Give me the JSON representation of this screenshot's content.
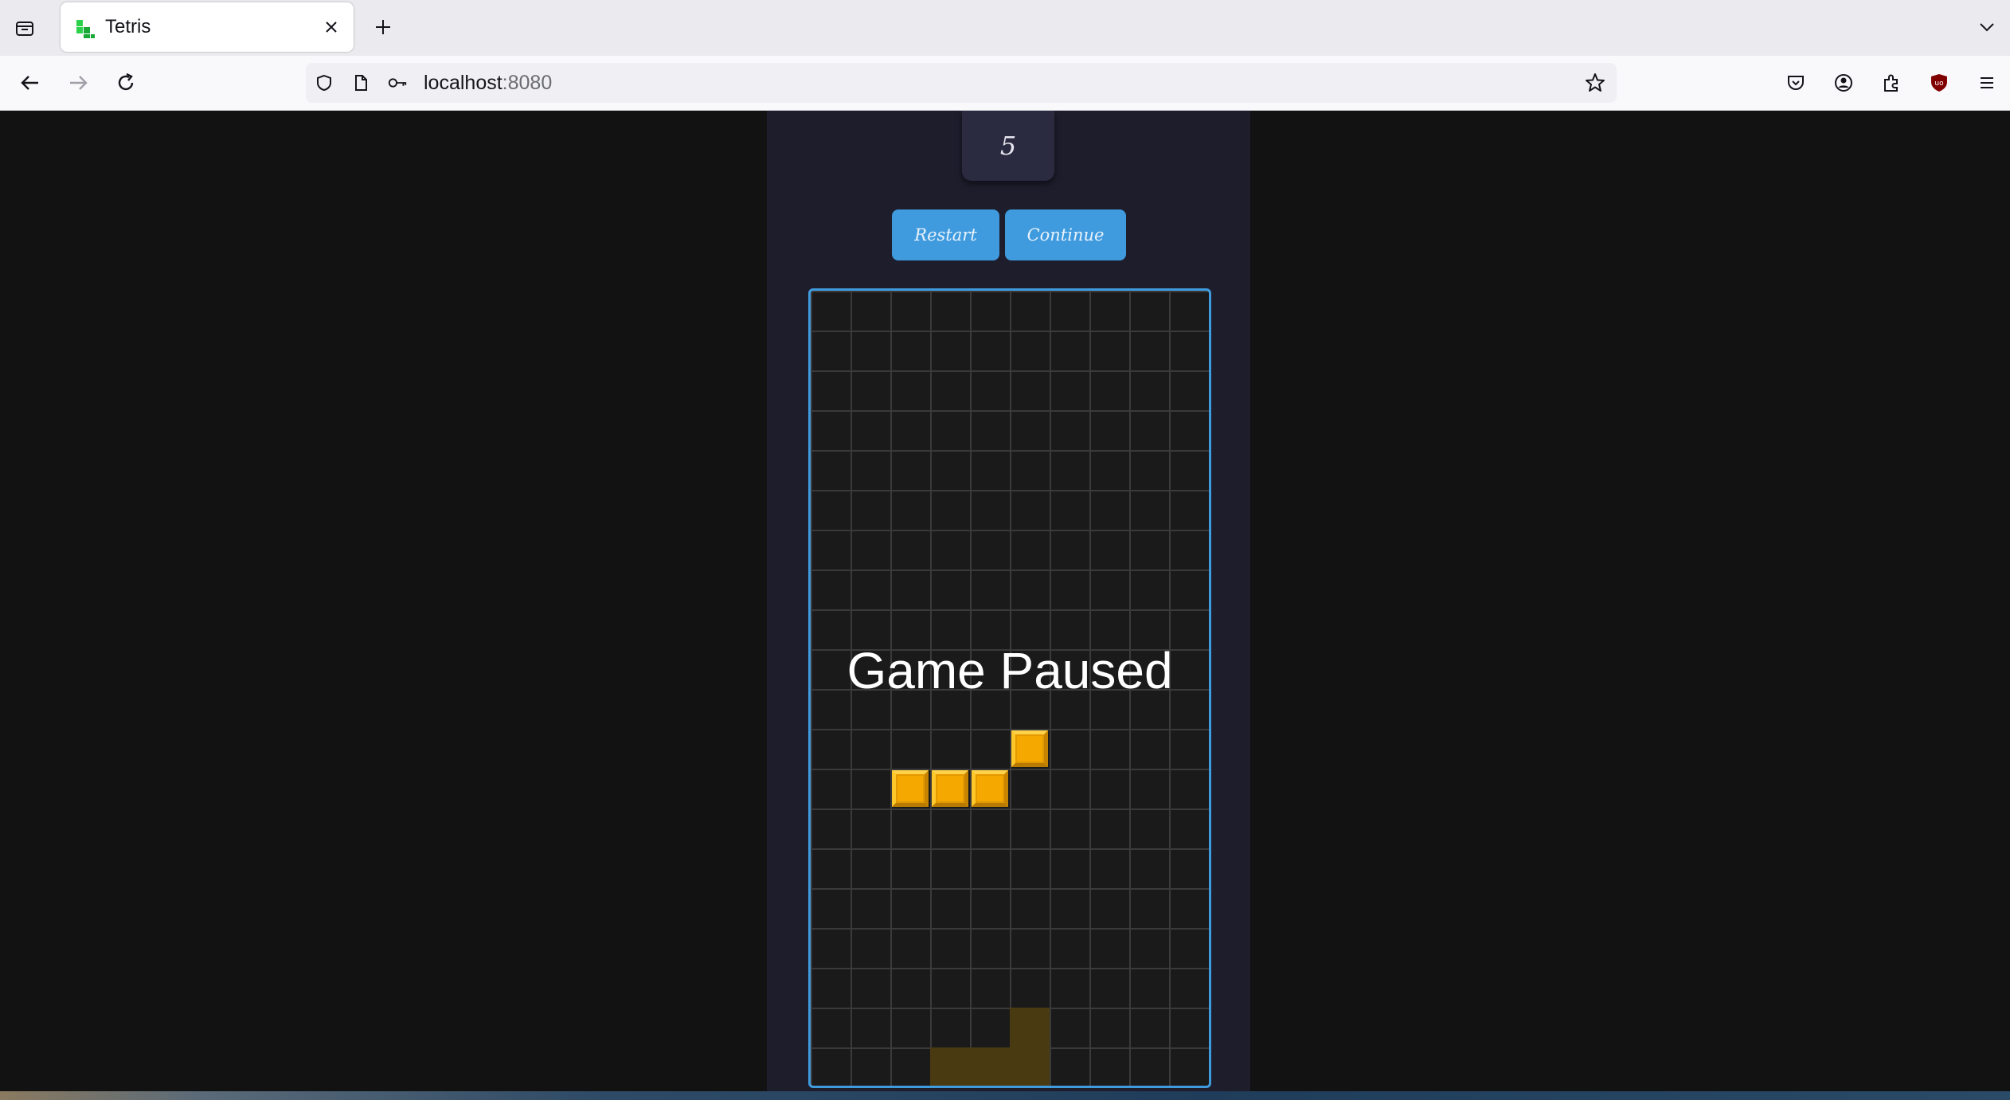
{
  "browser": {
    "tab": {
      "title": "Tetris"
    },
    "url": {
      "host": "localhost",
      "port": ":8080"
    }
  },
  "game": {
    "score_value": "5",
    "buttons": {
      "restart": "Restart",
      "continue": "Continue"
    },
    "pause_message": "Game Paused",
    "board": {
      "columns": 10,
      "rows": 20,
      "active_piece": {
        "type": "L",
        "color": "#f5a800",
        "cells": [
          [
            5,
            11
          ],
          [
            2,
            12
          ],
          [
            3,
            12
          ],
          [
            4,
            12
          ]
        ]
      },
      "ghost_piece": {
        "color": "#4a3a12",
        "cells": [
          [
            5,
            18
          ],
          [
            3,
            19
          ],
          [
            4,
            19
          ],
          [
            5,
            19
          ]
        ]
      }
    }
  },
  "colors": {
    "accent": "#3f9bde",
    "panel": "#1d1d2c",
    "background": "#121212"
  }
}
